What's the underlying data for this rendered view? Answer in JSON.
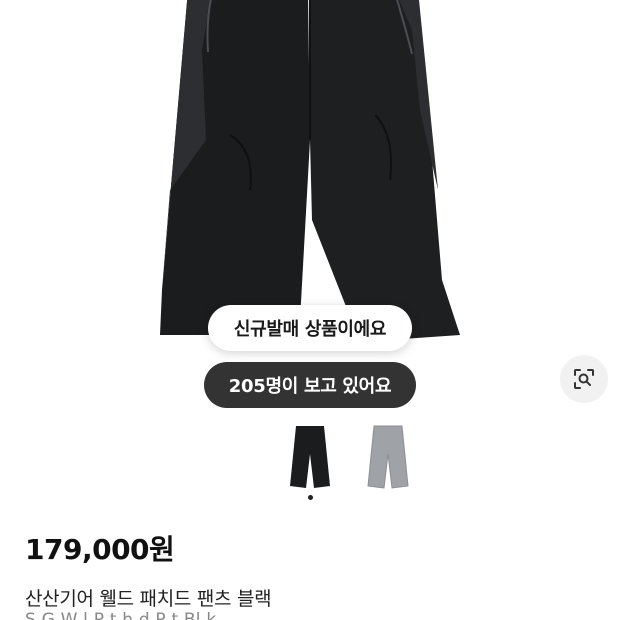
{
  "product": {
    "badge_new": "신규발매 상품이에요",
    "viewers_label": "205명이 보고 있어요",
    "price": "179,000원",
    "title": "산산기어 웰드 패치드 팬츠 블랙",
    "subtitle_partial": "S      G      W  l  P  t  h  d P  t  Bl  k"
  },
  "gallery": {
    "thumbnails": [
      {
        "name": "black",
        "color": "#1b1c1e"
      },
      {
        "name": "grey",
        "color": "#9fa2a6"
      }
    ],
    "page_dots": 1
  },
  "icons": {
    "lens": "image-search-icon"
  },
  "colors": {
    "pants_main": "#1b1c1e",
    "pants_panel": "#2c2e31",
    "pill_dark": "#333333",
    "lens_bg": "#f1f1f1"
  }
}
